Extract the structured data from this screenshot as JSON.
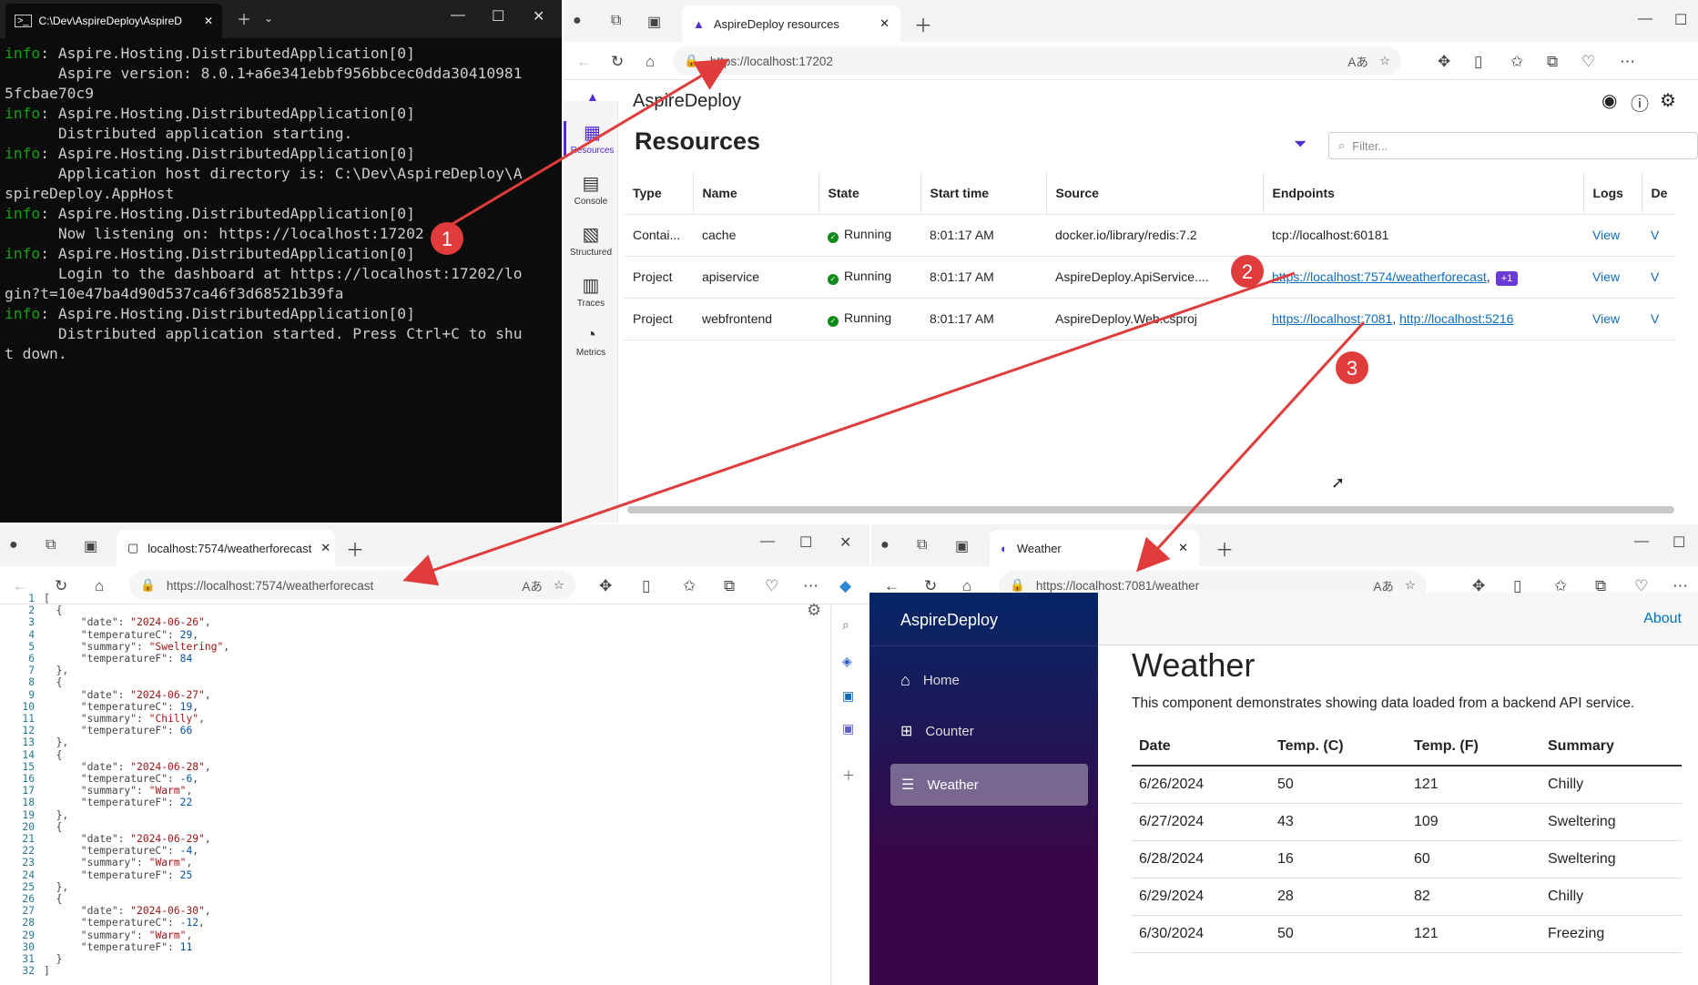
{
  "terminal": {
    "title": "C:\\Dev\\AspireDeploy\\AspireD",
    "lines": [
      {
        "p": "info",
        "t": ": Aspire.Hosting.DistributedApplication[0]"
      },
      {
        "p": "",
        "t": "      Aspire version: 8.0.1+a6e341ebbf956bbcec0dda30410981\n5fcbae70c9"
      },
      {
        "p": "info",
        "t": ": Aspire.Hosting.DistributedApplication[0]"
      },
      {
        "p": "",
        "t": "      Distributed application starting."
      },
      {
        "p": "info",
        "t": ": Aspire.Hosting.DistributedApplication[0]"
      },
      {
        "p": "",
        "t": "      Application host directory is: C:\\Dev\\AspireDeploy\\A\nspireDeploy.AppHost"
      },
      {
        "p": "info",
        "t": ": Aspire.Hosting.DistributedApplication[0]"
      },
      {
        "p": "",
        "t": "      Now listening on: https://localhost:17202"
      },
      {
        "p": "info",
        "t": ": Aspire.Hosting.DistributedApplication[0]"
      },
      {
        "p": "",
        "t": "      Login to the dashboard at https://localhost:17202/lo\ngin?t=10e47ba4d90d537ca46f3d68521b39fa"
      },
      {
        "p": "info",
        "t": ": Aspire.Hosting.DistributedApplication[0]"
      },
      {
        "p": "",
        "t": "      Distributed application started. Press Ctrl+C to shu\nt down."
      }
    ]
  },
  "dashboard": {
    "tab_title": "AspireDeploy resources",
    "url": "https://localhost:17202",
    "app_name": "AspireDeploy",
    "page_title": "Resources",
    "filter_placeholder": "Filter...",
    "nav": [
      "Resources",
      "Console",
      "Structured",
      "Traces",
      "Metrics"
    ],
    "columns": [
      "Type",
      "Name",
      "State",
      "Start time",
      "Source",
      "Endpoints",
      "Logs",
      "De"
    ],
    "rows": [
      {
        "type": "Contai...",
        "name": "cache",
        "state": "Running",
        "start": "8:01:17 AM",
        "source": "docker.io/library/redis:7.2",
        "ep1": "tcp://localhost:60181",
        "ep2": "",
        "badge": "",
        "logs": "View"
      },
      {
        "type": "Project",
        "name": "apiservice",
        "state": "Running",
        "start": "8:01:17 AM",
        "source": "AspireDeploy.ApiService....",
        "ep1": "https://localhost:7574/weatherforecast",
        "ep2": "",
        "badge": "+1",
        "logs": "View"
      },
      {
        "type": "Project",
        "name": "webfrontend",
        "state": "Running",
        "start": "8:01:17 AM",
        "source": "AspireDeploy.Web.csproj",
        "ep1": "https://localhost:7081",
        "ep2": "http://localhost:5216",
        "badge": "",
        "logs": "View"
      }
    ]
  },
  "api_browser": {
    "tab_title": "localhost:7574/weatherforecast",
    "url": "https://localhost:7574/weatherforecast"
  },
  "json_view": [
    {
      "date": "2024-06-26",
      "c": "29",
      "summary": "Sweltering",
      "f": "84"
    },
    {
      "date": "2024-06-27",
      "c": "19",
      "summary": "Chilly",
      "f": "66"
    },
    {
      "date": "2024-06-28",
      "c": "-6",
      "summary": "Warm",
      "f": "22"
    },
    {
      "date": "2024-06-29",
      "c": "-4",
      "summary": "Warm",
      "f": "25"
    },
    {
      "date": "2024-06-30",
      "c": "-12",
      "summary": "Warm",
      "f": "11"
    }
  ],
  "web_browser": {
    "tab_title": "Weather",
    "url": "https://localhost:7081/weather",
    "brand": "AspireDeploy",
    "about": "About",
    "nav": [
      "Home",
      "Counter",
      "Weather"
    ],
    "heading": "Weather",
    "intro": "This component demonstrates showing data loaded from a backend API service.",
    "cols": [
      "Date",
      "Temp. (C)",
      "Temp. (F)",
      "Summary"
    ],
    "rows": [
      [
        "6/26/2024",
        "50",
        "121",
        "Chilly"
      ],
      [
        "6/27/2024",
        "43",
        "109",
        "Sweltering"
      ],
      [
        "6/28/2024",
        "16",
        "60",
        "Sweltering"
      ],
      [
        "6/29/2024",
        "28",
        "82",
        "Chilly"
      ],
      [
        "6/30/2024",
        "50",
        "121",
        "Freezing"
      ]
    ]
  },
  "callouts": [
    "1",
    "2",
    "3"
  ],
  "colors": {
    "arrow": "#e03c3c",
    "aspire_purple": "#512bd4",
    "link": "#0f6cbd",
    "running": "#0e8a16"
  }
}
